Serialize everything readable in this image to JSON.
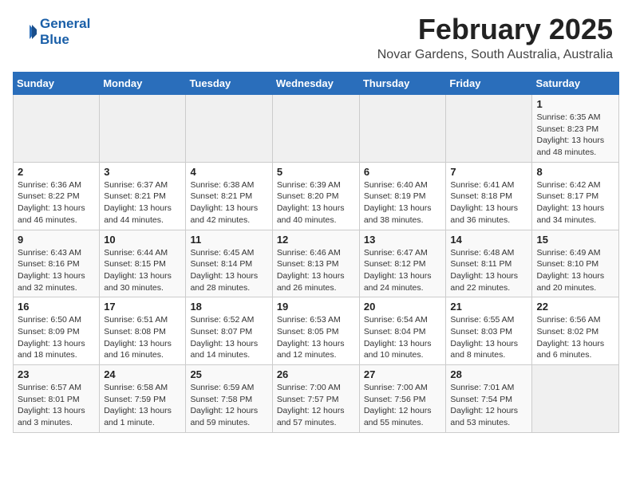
{
  "logo": {
    "line1": "General",
    "line2": "Blue"
  },
  "header": {
    "title": "February 2025",
    "subtitle": "Novar Gardens, South Australia, Australia"
  },
  "weekdays": [
    "Sunday",
    "Monday",
    "Tuesday",
    "Wednesday",
    "Thursday",
    "Friday",
    "Saturday"
  ],
  "weeks": [
    [
      {
        "day": "",
        "info": ""
      },
      {
        "day": "",
        "info": ""
      },
      {
        "day": "",
        "info": ""
      },
      {
        "day": "",
        "info": ""
      },
      {
        "day": "",
        "info": ""
      },
      {
        "day": "",
        "info": ""
      },
      {
        "day": "1",
        "info": "Sunrise: 6:35 AM\nSunset: 8:23 PM\nDaylight: 13 hours and 48 minutes."
      }
    ],
    [
      {
        "day": "2",
        "info": "Sunrise: 6:36 AM\nSunset: 8:22 PM\nDaylight: 13 hours and 46 minutes."
      },
      {
        "day": "3",
        "info": "Sunrise: 6:37 AM\nSunset: 8:21 PM\nDaylight: 13 hours and 44 minutes."
      },
      {
        "day": "4",
        "info": "Sunrise: 6:38 AM\nSunset: 8:21 PM\nDaylight: 13 hours and 42 minutes."
      },
      {
        "day": "5",
        "info": "Sunrise: 6:39 AM\nSunset: 8:20 PM\nDaylight: 13 hours and 40 minutes."
      },
      {
        "day": "6",
        "info": "Sunrise: 6:40 AM\nSunset: 8:19 PM\nDaylight: 13 hours and 38 minutes."
      },
      {
        "day": "7",
        "info": "Sunrise: 6:41 AM\nSunset: 8:18 PM\nDaylight: 13 hours and 36 minutes."
      },
      {
        "day": "8",
        "info": "Sunrise: 6:42 AM\nSunset: 8:17 PM\nDaylight: 13 hours and 34 minutes."
      }
    ],
    [
      {
        "day": "9",
        "info": "Sunrise: 6:43 AM\nSunset: 8:16 PM\nDaylight: 13 hours and 32 minutes."
      },
      {
        "day": "10",
        "info": "Sunrise: 6:44 AM\nSunset: 8:15 PM\nDaylight: 13 hours and 30 minutes."
      },
      {
        "day": "11",
        "info": "Sunrise: 6:45 AM\nSunset: 8:14 PM\nDaylight: 13 hours and 28 minutes."
      },
      {
        "day": "12",
        "info": "Sunrise: 6:46 AM\nSunset: 8:13 PM\nDaylight: 13 hours and 26 minutes."
      },
      {
        "day": "13",
        "info": "Sunrise: 6:47 AM\nSunset: 8:12 PM\nDaylight: 13 hours and 24 minutes."
      },
      {
        "day": "14",
        "info": "Sunrise: 6:48 AM\nSunset: 8:11 PM\nDaylight: 13 hours and 22 minutes."
      },
      {
        "day": "15",
        "info": "Sunrise: 6:49 AM\nSunset: 8:10 PM\nDaylight: 13 hours and 20 minutes."
      }
    ],
    [
      {
        "day": "16",
        "info": "Sunrise: 6:50 AM\nSunset: 8:09 PM\nDaylight: 13 hours and 18 minutes."
      },
      {
        "day": "17",
        "info": "Sunrise: 6:51 AM\nSunset: 8:08 PM\nDaylight: 13 hours and 16 minutes."
      },
      {
        "day": "18",
        "info": "Sunrise: 6:52 AM\nSunset: 8:07 PM\nDaylight: 13 hours and 14 minutes."
      },
      {
        "day": "19",
        "info": "Sunrise: 6:53 AM\nSunset: 8:05 PM\nDaylight: 13 hours and 12 minutes."
      },
      {
        "day": "20",
        "info": "Sunrise: 6:54 AM\nSunset: 8:04 PM\nDaylight: 13 hours and 10 minutes."
      },
      {
        "day": "21",
        "info": "Sunrise: 6:55 AM\nSunset: 8:03 PM\nDaylight: 13 hours and 8 minutes."
      },
      {
        "day": "22",
        "info": "Sunrise: 6:56 AM\nSunset: 8:02 PM\nDaylight: 13 hours and 6 minutes."
      }
    ],
    [
      {
        "day": "23",
        "info": "Sunrise: 6:57 AM\nSunset: 8:01 PM\nDaylight: 13 hours and 3 minutes."
      },
      {
        "day": "24",
        "info": "Sunrise: 6:58 AM\nSunset: 7:59 PM\nDaylight: 13 hours and 1 minute."
      },
      {
        "day": "25",
        "info": "Sunrise: 6:59 AM\nSunset: 7:58 PM\nDaylight: 12 hours and 59 minutes."
      },
      {
        "day": "26",
        "info": "Sunrise: 7:00 AM\nSunset: 7:57 PM\nDaylight: 12 hours and 57 minutes."
      },
      {
        "day": "27",
        "info": "Sunrise: 7:00 AM\nSunset: 7:56 PM\nDaylight: 12 hours and 55 minutes."
      },
      {
        "day": "28",
        "info": "Sunrise: 7:01 AM\nSunset: 7:54 PM\nDaylight: 12 hours and 53 minutes."
      },
      {
        "day": "",
        "info": ""
      }
    ]
  ]
}
